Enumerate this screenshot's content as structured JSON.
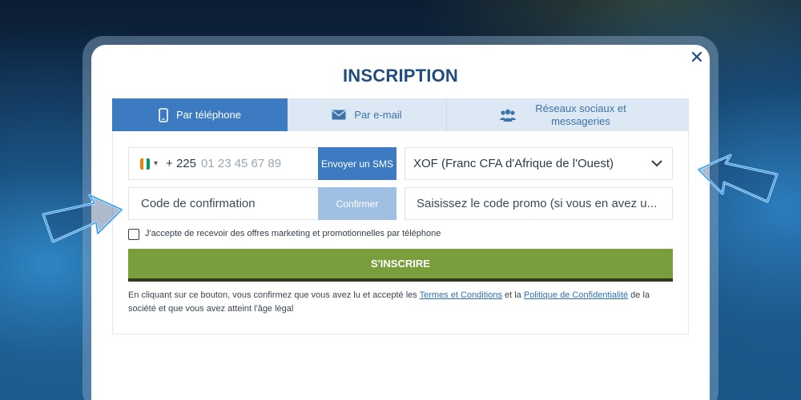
{
  "modal": {
    "title": "INSCRIPTION",
    "close_icon": "close-icon"
  },
  "tabs": [
    {
      "label": "Par téléphone",
      "icon": "phone-icon",
      "active": true
    },
    {
      "label": "Par e-mail",
      "icon": "envelope-icon",
      "active": false
    },
    {
      "label": "Réseaux sociaux et messageries",
      "icon": "users-icon",
      "active": false
    }
  ],
  "phone": {
    "dial_code": "+ 225",
    "placeholder": "01 23 45 67 89",
    "flag_colors": [
      "#f77f00",
      "#ffffff",
      "#009e60"
    ],
    "send_sms_label": "Envoyer un SMS"
  },
  "currency": {
    "selected": "XOF (Franc CFA d'Afrique de l'Ouest)"
  },
  "confirmation": {
    "placeholder": "Code de confirmation",
    "confirm_label": "Confirmer"
  },
  "promo": {
    "placeholder": "Saisissez le code promo (si vous en avez u..."
  },
  "marketing": {
    "label": "J'accepte de recevoir des offres marketing et promotionnelles par téléphone",
    "checked": false
  },
  "submit": {
    "label": "S'INSCRIRE"
  },
  "legal": {
    "text_before": "En cliquant sur ce bouton, vous confirmez que vous avez lu et accepté les ",
    "terms_link": "Termes et Conditions",
    "text_middle": " et la ",
    "privacy_link": "Politique de Confidentialité",
    "text_after": " de la société et que vous avez atteint l'âge légal"
  },
  "colors": {
    "accent": "#3c7bc2",
    "submit_green": "#7a9e3b",
    "title": "#1f4d7e"
  }
}
